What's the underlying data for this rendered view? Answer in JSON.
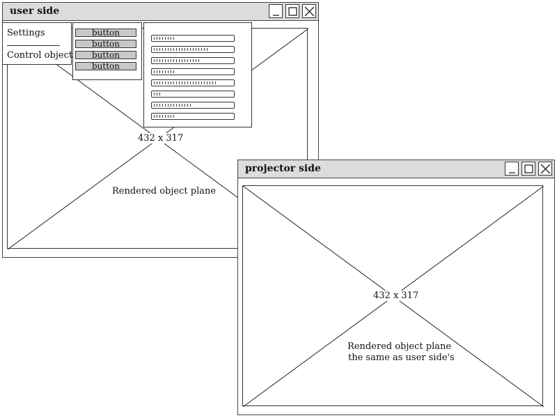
{
  "user_window": {
    "title": "user side",
    "plane_dimensions": "432 x 317",
    "plane_caption": "Rendered object plane",
    "menu": {
      "items": [
        "Settings",
        "Control object"
      ]
    },
    "button_panel": {
      "buttons": [
        "button",
        "button",
        "button",
        "button"
      ]
    },
    "list_panel": {
      "rows": [
        {
          "fill": 0.27
        },
        {
          "fill": 0.73
        },
        {
          "fill": 0.61
        },
        {
          "fill": 0.28
        },
        {
          "fill": 0.84
        },
        {
          "fill": 0.1
        },
        {
          "fill": 0.49
        },
        {
          "fill": 0.28
        }
      ]
    }
  },
  "projector_window": {
    "title": "projector side",
    "plane_dimensions": "432 x 317",
    "plane_caption_line1": "Rendered object plane",
    "plane_caption_line2": "the same as user side's"
  },
  "icons": {
    "minimize": "minimize-icon",
    "maximize": "maximize-icon",
    "close": "close-icon"
  }
}
